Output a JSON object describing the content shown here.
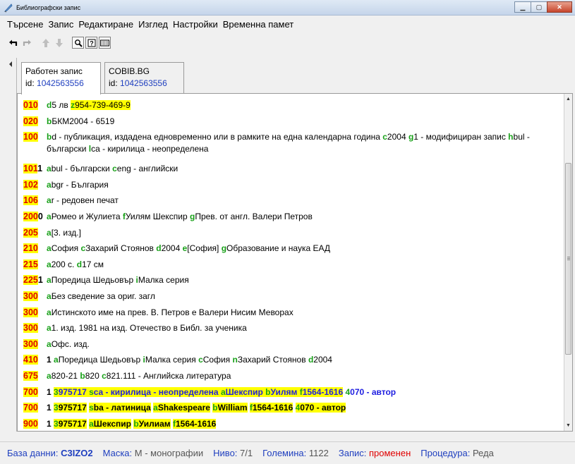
{
  "window": {
    "title": "Библиографски запис",
    "min_icon": "minimize-icon",
    "max_icon": "maximize-icon",
    "close_icon": "close-icon"
  },
  "menu": [
    "Търсене",
    "Запис",
    "Редактиране",
    "Изглед",
    "Настройки",
    "Временна памет"
  ],
  "toolbar_icons": [
    "undo-arrow-icon",
    "redo-arrow-icon",
    "move-up-icon",
    "move-down-icon",
    "search-icon",
    "help-icon",
    "keyboard-icon"
  ],
  "tabs": [
    {
      "title": "Работен запис",
      "id_label": "id:",
      "id_value": "1042563556"
    },
    {
      "title": "COBIB.BG",
      "id_label": "id:",
      "id_value": "1042563556"
    }
  ],
  "rows": [
    {
      "tag": "010",
      "ind": "",
      "parts": [
        [
          "sub",
          "d"
        ],
        [
          "t",
          "5 лв "
        ],
        [
          "hlsub",
          "z"
        ],
        [
          "hl",
          "954-739-469-9"
        ]
      ]
    },
    {
      "tag": "020",
      "ind": "",
      "parts": [
        [
          "sub",
          "b"
        ],
        [
          "t",
          "БКМ2004 - 6519"
        ]
      ]
    },
    {
      "tag": "100",
      "ind": "",
      "tall": true,
      "parts": [
        [
          "sub",
          "b"
        ],
        [
          "t",
          "d - публикация, издадена едновременно или в рамките на една календарна година "
        ],
        [
          "sub",
          "c"
        ],
        [
          "t",
          "2004 "
        ],
        [
          "sub",
          "g"
        ],
        [
          "t",
          "1 - модифициран запис "
        ],
        [
          "sub",
          "h"
        ],
        [
          "t",
          "bul - български "
        ],
        [
          "sub",
          "l"
        ],
        [
          "t",
          "ca - кирилица - неопределена"
        ]
      ]
    },
    {
      "tag": "101",
      "ind": "1",
      "parts": [
        [
          "sub",
          "a"
        ],
        [
          "t",
          "bul - български "
        ],
        [
          "sub",
          "c"
        ],
        [
          "t",
          "eng - английски"
        ]
      ]
    },
    {
      "tag": "102",
      "ind": "",
      "parts": [
        [
          "sub",
          "a"
        ],
        [
          "t",
          "bgr - България"
        ]
      ]
    },
    {
      "tag": "106",
      "ind": "",
      "parts": [
        [
          "sub",
          "a"
        ],
        [
          "t",
          "r - редовен печат"
        ]
      ]
    },
    {
      "tag": "200",
      "ind": "0",
      "parts": [
        [
          "sub",
          "a"
        ],
        [
          "t",
          "Ромео и Жулиета "
        ],
        [
          "sub",
          "f"
        ],
        [
          "t",
          "Уилям Шекспир "
        ],
        [
          "sub",
          "g"
        ],
        [
          "t",
          "Прев. от англ. Валери Петров"
        ]
      ]
    },
    {
      "tag": "205",
      "ind": "",
      "parts": [
        [
          "sub",
          "a"
        ],
        [
          "t",
          "[3. изд.]"
        ]
      ]
    },
    {
      "tag": "210",
      "ind": "",
      "parts": [
        [
          "sub",
          "a"
        ],
        [
          "t",
          "София "
        ],
        [
          "sub",
          "c"
        ],
        [
          "t",
          "Захарий Стоянов "
        ],
        [
          "sub",
          "d"
        ],
        [
          "t",
          "2004 "
        ],
        [
          "sub",
          "e"
        ],
        [
          "t",
          "[София] "
        ],
        [
          "sub",
          "g"
        ],
        [
          "t",
          "Образование и наука ЕАД"
        ]
      ]
    },
    {
      "tag": "215",
      "ind": "",
      "parts": [
        [
          "sub",
          "a"
        ],
        [
          "t",
          "200 с. "
        ],
        [
          "sub",
          "d"
        ],
        [
          "t",
          "17 см"
        ]
      ]
    },
    {
      "tag": "225",
      "ind": "1",
      "parts": [
        [
          "sub",
          "a"
        ],
        [
          "t",
          "Поредица Шедьовър "
        ],
        [
          "sub",
          "i"
        ],
        [
          "t",
          "Малка серия"
        ]
      ]
    },
    {
      "tag": "300",
      "ind": "",
      "parts": [
        [
          "sub",
          "a"
        ],
        [
          "t",
          "Без сведение за ориг. загл"
        ]
      ]
    },
    {
      "tag": "300",
      "ind": "",
      "parts": [
        [
          "sub",
          "a"
        ],
        [
          "t",
          "Истинското име на прев. В. Петров е Валери Нисим Меворах"
        ]
      ]
    },
    {
      "tag": "300",
      "ind": "",
      "parts": [
        [
          "sub",
          "a"
        ],
        [
          "t",
          "1. изд. 1981 на изд. Отечество в Библ. за ученика"
        ]
      ]
    },
    {
      "tag": "300",
      "ind": "",
      "parts": [
        [
          "sub",
          "a"
        ],
        [
          "t",
          "Офс. изд."
        ]
      ]
    },
    {
      "tag": "410",
      "ind": "",
      "parts": [
        [
          "b",
          " 1 "
        ],
        [
          "sub",
          "a"
        ],
        [
          "t",
          "Поредица Шедьовър "
        ],
        [
          "sub",
          "i"
        ],
        [
          "t",
          "Малка серия "
        ],
        [
          "sub",
          "c"
        ],
        [
          "t",
          "София "
        ],
        [
          "sub",
          "n"
        ],
        [
          "t",
          "Захарий Стоянов "
        ],
        [
          "sub",
          "d"
        ],
        [
          "t",
          "2004"
        ]
      ]
    },
    {
      "tag": "675",
      "ind": "",
      "parts": [
        [
          "sub",
          "a"
        ],
        [
          "t",
          "820-21 "
        ],
        [
          "sub",
          "b"
        ],
        [
          "t",
          "820 "
        ],
        [
          "sub",
          "c"
        ],
        [
          "t",
          "821.111 - Английска литература"
        ]
      ]
    },
    {
      "tag": "700",
      "ind": "",
      "parts": [
        [
          "b",
          " 1 "
        ],
        [
          "hlsub",
          "3"
        ],
        [
          "hlblue",
          "975717 "
        ],
        [
          "hlsub",
          "s"
        ],
        [
          "hlblue",
          "ca - кирилица - неопределена "
        ],
        [
          "hlsub",
          "a"
        ],
        [
          "hlblue",
          "Шекспир "
        ],
        [
          "hlsub",
          "b"
        ],
        [
          "hlblue",
          "Уилям "
        ],
        [
          "hlsub",
          "f"
        ],
        [
          "hlblue",
          "1564-1616"
        ],
        [
          "blue",
          " "
        ],
        [
          "subblue",
          "4"
        ],
        [
          "blue",
          "070 - автор"
        ]
      ]
    },
    {
      "tag": "700",
      "ind": "",
      "parts": [
        [
          "b",
          " 1 "
        ],
        [
          "hlsub",
          "3"
        ],
        [
          "hlb",
          "975717"
        ],
        [
          "t",
          " "
        ],
        [
          "hlsub",
          "s"
        ],
        [
          "hlb",
          "ba - латиница"
        ],
        [
          "t",
          " "
        ],
        [
          "hlsub",
          "a"
        ],
        [
          "hlb",
          "Shakespeare"
        ],
        [
          "t",
          " "
        ],
        [
          "hlsub",
          "b"
        ],
        [
          "hlb",
          "William"
        ],
        [
          "t",
          " "
        ],
        [
          "hlsub",
          "f"
        ],
        [
          "hlb",
          "1564-1616"
        ],
        [
          "t",
          " "
        ],
        [
          "hlsub",
          "4"
        ],
        [
          "hlb",
          "070 - автор"
        ]
      ]
    },
    {
      "tag": "900",
      "ind": "",
      "parts": [
        [
          "b",
          " 1 "
        ],
        [
          "hlsub",
          "3"
        ],
        [
          "hlb",
          "975717"
        ],
        [
          "t",
          " "
        ],
        [
          "hlsub",
          "a"
        ],
        [
          "hlb",
          "Шекспир"
        ],
        [
          "t",
          " "
        ],
        [
          "hlsub",
          "b"
        ],
        [
          "hlb",
          "Уилиам"
        ],
        [
          "t",
          " "
        ],
        [
          "hlsub",
          "f"
        ],
        [
          "hlb",
          "1564-1616"
        ]
      ]
    }
  ],
  "status": {
    "db_label": "База данни:",
    "db_value": "C3IZO2",
    "mask_label": "Маска:",
    "mask_value": "M - монографии",
    "level_label": "Ниво:",
    "level_value": "7/1",
    "size_label": "Големина:",
    "size_value": "1122",
    "record_label": "Запис:",
    "record_value": "променен",
    "proc_label": "Процедура:",
    "proc_value": "Реда"
  }
}
